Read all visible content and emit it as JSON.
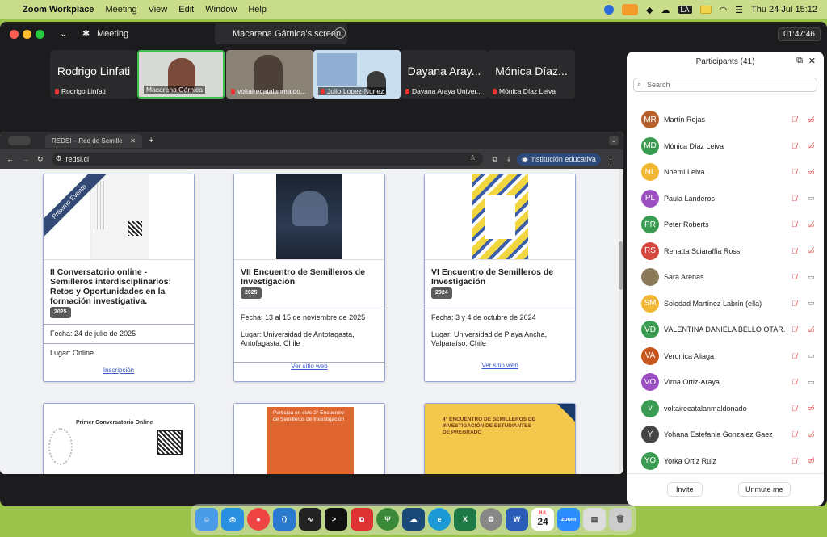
{
  "menubar": {
    "app": "Zoom Workplace",
    "items": [
      "Meeting",
      "View",
      "Edit",
      "Window",
      "Help"
    ],
    "user_initials": "LA",
    "datetime": "Thu 24 Jul  15:12"
  },
  "zoom": {
    "meeting_label": "Meeting",
    "share_label": "Macarena Gárnica's screen",
    "timer": "01:47:46"
  },
  "tiles": [
    {
      "big": "Rodrigo Linfati",
      "name": "Rodrigo Linfati"
    },
    {
      "big": "",
      "name": "Macarena Gárnica"
    },
    {
      "big": "",
      "name": "voltairecatalanmaldo..."
    },
    {
      "big": "",
      "name": "Julio Lopez-Nunez"
    },
    {
      "big": "Dayana Aray...",
      "name": "Dayana Araya Univer..."
    },
    {
      "big": "Mónica Díaz...",
      "name": "Mónica Díaz Leiva"
    }
  ],
  "browser": {
    "tab": "REDSI – Red de Semilleros de",
    "url": "redsi.cl",
    "profile": "Institución educativa"
  },
  "cards": [
    {
      "ribbon": "Próximo Evento",
      "title": "II Conversatorio online - Semilleros interdisciplinarios: Retos y Oportunidades en la formación investigativa.",
      "year": "2025",
      "date": "Fecha: 24 de julio de 2025",
      "place": "Lugar: Online",
      "link": "Inscripción"
    },
    {
      "title": "VII Encuentro de Semilleros de Investigación",
      "year": "2025",
      "date": "Fecha: 13 al 15 de noviembre de 2025",
      "place": "Lugar: Universidad de Antofagasta, Antofagasta, Chile",
      "link": "Ver sitio web"
    },
    {
      "title": "VI Encuentro de Semilleros de Investigación",
      "year": "2024",
      "date": "Fecha: 3 y 4 de octubre de 2024",
      "place": "Lugar: Universidad de Playa Ancha, Valparaíso, Chile",
      "link": "Ver sitio web"
    }
  ],
  "posters2": [
    "Primer Conversatorio Online",
    "Participa en este 2° Encuentro de Semilleros de Investigación",
    "4° ENCUENTRO DE SEMILLEROS DE INVESTIGACIÓN DE ESTUDIANTES DE PREGRADO"
  ],
  "participants": {
    "title": "Participants (41)",
    "search_placeholder": "Search",
    "invite": "Invite",
    "unmute": "Unmute me",
    "list": [
      {
        "initials": "MR",
        "name": "Martín Rojas",
        "color": "#b5602d",
        "video_off": true
      },
      {
        "initials": "MD",
        "name": "Mónica Díaz Leiva",
        "color": "#3a9c52",
        "video_off": true
      },
      {
        "initials": "NL",
        "name": "Noemí Leiva",
        "color": "#f2b731",
        "video_off": true
      },
      {
        "initials": "PL",
        "name": "Paula Landeros",
        "color": "#9b4fc2",
        "video_off": false
      },
      {
        "initials": "PR",
        "name": "Peter Roberts",
        "color": "#3a9c52",
        "video_off": true
      },
      {
        "initials": "RS",
        "name": "Renatta Sciaraffia Ross",
        "color": "#d6453d",
        "video_off": true
      },
      {
        "initials": "",
        "name": "Sara Arenas",
        "color": "#8a7a5a",
        "video_off": false
      },
      {
        "initials": "SM",
        "name": "Soledad Martínez Labrín (ella)",
        "color": "#f2b731",
        "video_off": false
      },
      {
        "initials": "VD",
        "name": "VALENTINA DANIELA BELLO OTAR...",
        "color": "#3a9c52",
        "video_off": true
      },
      {
        "initials": "VA",
        "name": "Veronica Aliaga",
        "color": "#c8571f",
        "video_off": false
      },
      {
        "initials": "VO",
        "name": "Virna Ortiz-Araya",
        "color": "#9b4fc2",
        "video_off": false
      },
      {
        "initials": "v",
        "name": "voltairecatalanmaldonado",
        "color": "#3a9c52",
        "video_off": true
      },
      {
        "initials": "Y",
        "name": "Yohana Estefania Gonzalez Gaez",
        "color": "#444",
        "video_off": true
      },
      {
        "initials": "YO",
        "name": "Yorka Ortiz Ruiz",
        "color": "#3a9c52",
        "video_off": true
      }
    ]
  },
  "dock": {
    "calendar_month": "JUL",
    "calendar_day": "24",
    "zoom_label": "zoom"
  }
}
